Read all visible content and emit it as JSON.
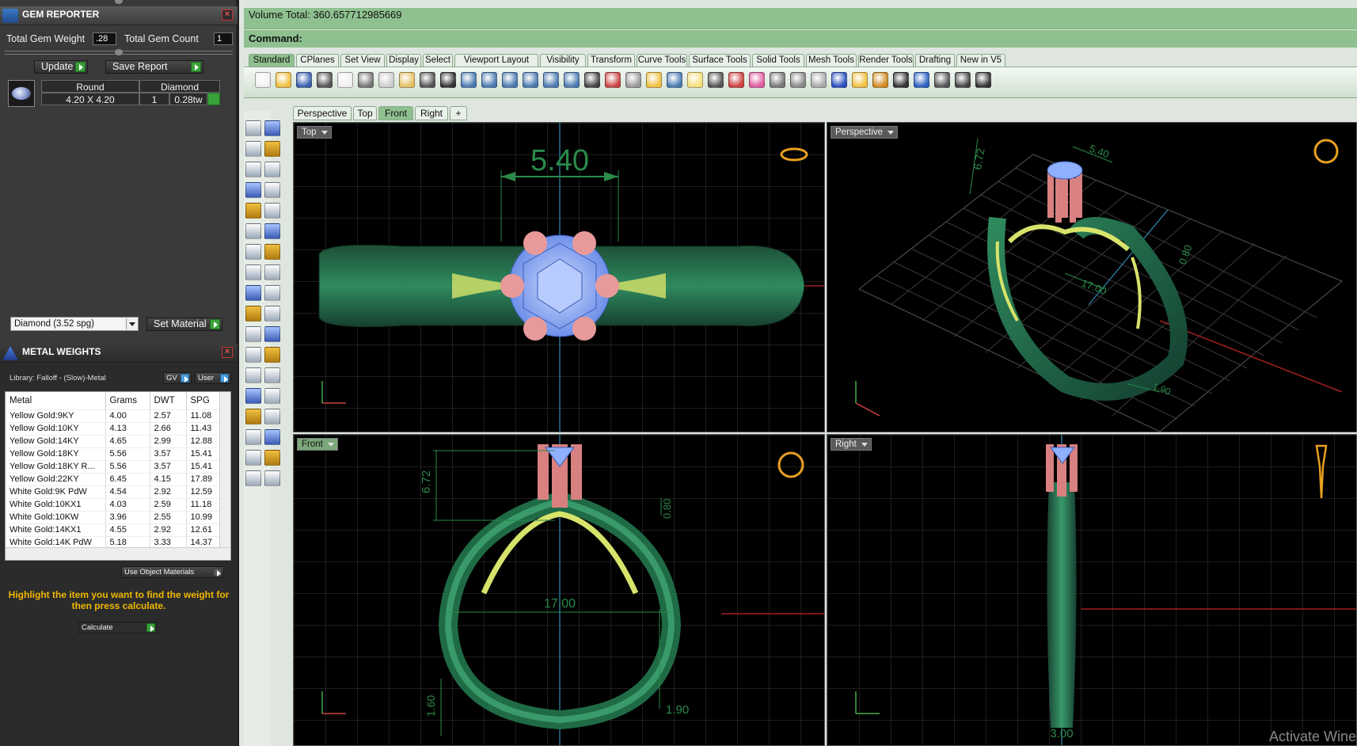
{
  "colors": {
    "accent_green": "#8fc08f",
    "ring_green": "#1f6b45",
    "prong_pink": "#d88a8a",
    "gem_blue": "#8fb0ff",
    "filigree_yellow": "#d7e36a",
    "hint_orange": "#f0b800"
  },
  "gem_reporter": {
    "title": "GEM REPORTER",
    "total_weight_label": "Total Gem Weight",
    "total_weight_value": ".28",
    "total_count_label": "Total Gem Count",
    "total_count_value": "1",
    "update_label": "Update",
    "save_label": "Save Report",
    "columns": [
      "Round",
      "Diamond"
    ],
    "gem_size": "4.20 X 4.20",
    "gem_qty": "1",
    "gem_tw": "0.28tw",
    "material_select": "Diamond     (3.52 spg)",
    "set_material_label": "Set Material"
  },
  "metal_weights": {
    "title": "METAL WEIGHTS",
    "library": "Library: Falloff - (Slow)-Metal",
    "gv_label": "GV",
    "user_label": "User",
    "columns": [
      "Metal",
      "Grams",
      "DWT",
      "SPG"
    ],
    "rows": [
      [
        "Yellow Gold:9KY",
        "4.00",
        "2.57",
        "11.08"
      ],
      [
        "Yellow Gold:10KY",
        "4.13",
        "2.66",
        "11.43"
      ],
      [
        "Yellow Gold:14KY",
        "4.65",
        "2.99",
        "12.88"
      ],
      [
        "Yellow Gold:18KY",
        "5.56",
        "3.57",
        "15.41"
      ],
      [
        "Yellow Gold:18KY R...",
        "5.56",
        "3.57",
        "15.41"
      ],
      [
        "Yellow Gold:22KY",
        "6.45",
        "4.15",
        "17.89"
      ],
      [
        "White Gold:9K PdW",
        "4.54",
        "2.92",
        "12.59"
      ],
      [
        "White Gold:10KX1",
        "4.03",
        "2.59",
        "11.18"
      ],
      [
        "White Gold:10KW",
        "3.96",
        "2.55",
        "10.99"
      ],
      [
        "White Gold:14KX1",
        "4.55",
        "2.92",
        "12.61"
      ],
      [
        "White Gold:14K PdW",
        "5.18",
        "3.33",
        "14.37"
      ]
    ],
    "use_object_materials": "Use Object Materials",
    "hint": "Highlight the item you want to find the weight for then press calculate.",
    "calculate_label": "Calculate"
  },
  "rhino": {
    "volume_total": "Volume Total: 360.657712985669",
    "command_label": "Command:",
    "toolbar_tabs": [
      "Standard",
      "CPlanes",
      "Set View",
      "Display",
      "Select",
      "Viewport Layout",
      "Visibility",
      "Transform",
      "Curve Tools",
      "Surface Tools",
      "Solid Tools",
      "Mesh Tools",
      "Render Tools",
      "Drafting",
      "New in V5"
    ],
    "viewport_tabs": [
      "Perspective",
      "Top",
      "Front",
      "Right",
      "+"
    ],
    "viewports": {
      "top": {
        "label": "Top",
        "dim": "5.40"
      },
      "perspective": {
        "label": "Perspective",
        "dims": [
          "5.40",
          "6.72",
          "17.00",
          "0.80",
          "1.90"
        ]
      },
      "front": {
        "label": "Front",
        "dims": [
          "6.72",
          "0.80",
          "17.00",
          "1.60",
          "1.90"
        ]
      },
      "right": {
        "label": "Right",
        "dim": "3.00"
      }
    },
    "watermark": "Activate Wine"
  }
}
